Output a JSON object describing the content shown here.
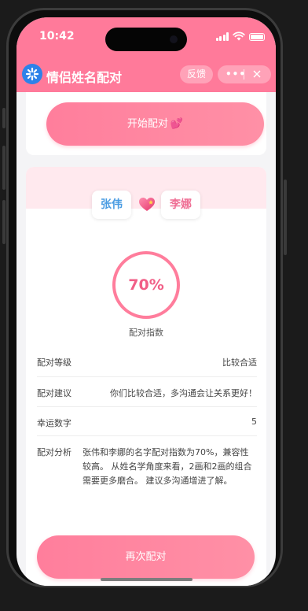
{
  "status_bar": {
    "time": "10:42"
  },
  "nav": {
    "title": "情侣姓名配对",
    "feedback": "反馈",
    "more": "•••"
  },
  "start_button": {
    "label": "开始配对",
    "emoji": "💕"
  },
  "result": {
    "name1": "张伟",
    "name2": "李娜",
    "score": "70%",
    "score_label": "配对指数",
    "details": [
      {
        "key": "配对等级",
        "value": "比较合适"
      },
      {
        "key": "配对建议",
        "value": "你们比较合适，多沟通会让关系更好！"
      },
      {
        "key": "幸运数字",
        "value": "5"
      },
      {
        "key": "配对分析",
        "value": "张伟和李娜的名字配对指数为70%，兼容性较高。 从姓名学角度来看，2画和2画的组合需要更多磨合。 建议多沟通增进了解。"
      }
    ]
  },
  "again_button": {
    "label": "再次配对"
  },
  "colors": {
    "accent": "#ff7a9a",
    "logo": "#2e82e9",
    "name1": "#4a9ce2",
    "name2": "#ef6f95"
  }
}
